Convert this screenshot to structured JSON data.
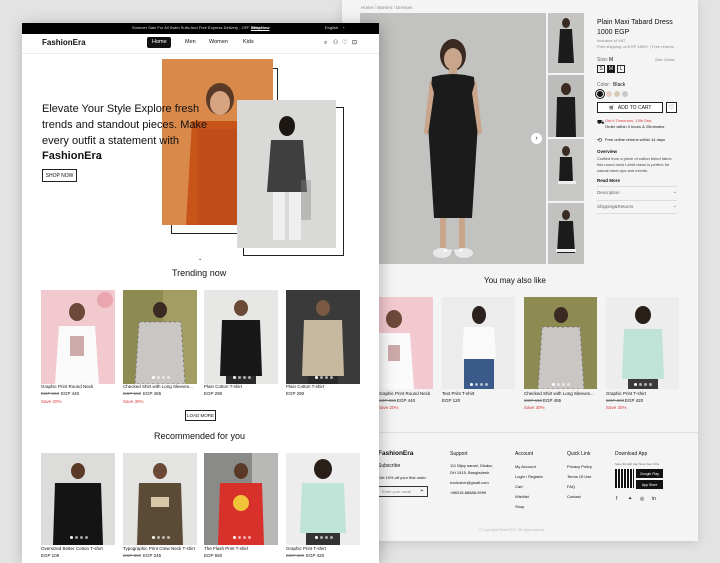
{
  "back": {
    "breadcrumb": "Home / Women / Dresses",
    "product": {
      "title_line1": "Plain Maxi Tabard Dress",
      "price": "1000 EGP",
      "vat": "Inclusive of VAT",
      "shipping": "Free shipping on EGP 1500+ | Free returns",
      "size_label": "Size:",
      "size_value": "M",
      "size_guide": "Size Guide",
      "sizes": [
        "S",
        "M",
        "L"
      ],
      "color_label": "Color:",
      "color_value": "Black",
      "add_to_cart": "ADD TO CART",
      "delivery_line1": "Get it Tomorrow, 13th Sep.",
      "delivery_line2": "Order within 3 hours & 25minutes",
      "returns": "Free online returns within 14 days",
      "overview_title": "Overview",
      "overview_text": [
        "Crafted from a piece of cotton blend fabric,",
        "this round neck t-shirt dress is perfect for",
        "casual meet-ups and events."
      ],
      "read_more": "Read More",
      "accordion": [
        "Description",
        "Shipping&Returns"
      ]
    },
    "also_like": {
      "heading": "You may also like",
      "items": [
        {
          "name": "Graphic Print Round Neck",
          "old": "EGP 550",
          "price": "EGP 440",
          "save": "Save 20%"
        },
        {
          "name": "Text Print T-shirt",
          "old": "",
          "price": "EGP 120",
          "save": ""
        },
        {
          "name": "Checked Shirt with Long Sleeves...",
          "old": "EGP 650",
          "price": "EGP 455",
          "save": "Save 30%"
        },
        {
          "name": "Graphic Print T-shirt",
          "old": "EGP 600",
          "price": "EGP 420",
          "save": "Save 30%"
        }
      ]
    },
    "footer": {
      "brand": "FashionEra",
      "subscribe_title": "Subscribe",
      "subscribe_text": "Get 10% off your first order",
      "email_placeholder": "Enter your email",
      "support_title": "Support",
      "support_lines": [
        "111 Bijoy sarani, Dhaka,",
        "DH 1515, Bangladesh.",
        "exclusive@gmail.com",
        "+88015-88888-9999"
      ],
      "account_title": "Account",
      "account_links": [
        "My Account",
        "Login / Register",
        "Cart",
        "Wishlist",
        "Shop"
      ],
      "quick_title": "Quick Link",
      "quick_links": [
        "Privacy Policy",
        "Terms Of Use",
        "FAQ",
        "Contact"
      ],
      "download_title": "Download App",
      "download_text": "Save $3 with App New User Only",
      "google_play": "Google Play",
      "app_store": "App Store",
      "copyright": "© Copyright Rimel 2022. All right reserved"
    }
  },
  "front": {
    "announcement": "Summer Sale For All Swim Suits And Free Express Delivery - OFF 50%!",
    "announcement_link": "ShopNow",
    "language": "English",
    "brand": "FashionEra",
    "nav": [
      "Home",
      "Men",
      "Women",
      "Kids"
    ],
    "hero": {
      "line1": "Elevate Your Style Explore fresh",
      "line2": "trends and standout pieces. Make",
      "line3": "every outfit a statement with",
      "line4": "FashionEra",
      "line4_end": ".",
      "cta": "SHOP NOW"
    },
    "trending": {
      "heading": "Trending now",
      "items": [
        {
          "name": "Graphic Print Round Neck",
          "old": "EGP 550",
          "price": "EGP 440",
          "save": "Save 20%"
        },
        {
          "name": "Checked Shirt with Long Sleeves...",
          "old": "EGP 650",
          "price": "EGP 455",
          "save": "Save 30%"
        },
        {
          "name": "Plain Cotton T-shirt",
          "old": "",
          "price": "EGP 290",
          "save": ""
        },
        {
          "name": "Plain Cotton T-shirt",
          "old": "",
          "price": "EGP 290",
          "save": ""
        }
      ],
      "load_more": "LOAD MORE"
    },
    "recommended": {
      "heading": "Recommended for you",
      "items": [
        {
          "name": "Oversized Better Cotton T-shirt",
          "old": "",
          "price": "EGP 108",
          "save": ""
        },
        {
          "name": "Typographic Print Crew Neck T-shirt",
          "old": "EGP 350",
          "price": "EGP 245",
          "save": ""
        },
        {
          "name": "The Flash Print T-shirt",
          "old": "",
          "price": "EGP 550",
          "save": ""
        },
        {
          "name": "Graphic Print T-shirt",
          "old": "EGP 600",
          "price": "EGP 420",
          "save": ""
        }
      ]
    }
  },
  "colors": {
    "accent_red": "#d43a3a",
    "black": "#111111",
    "hero_orange": "#d9894a"
  }
}
